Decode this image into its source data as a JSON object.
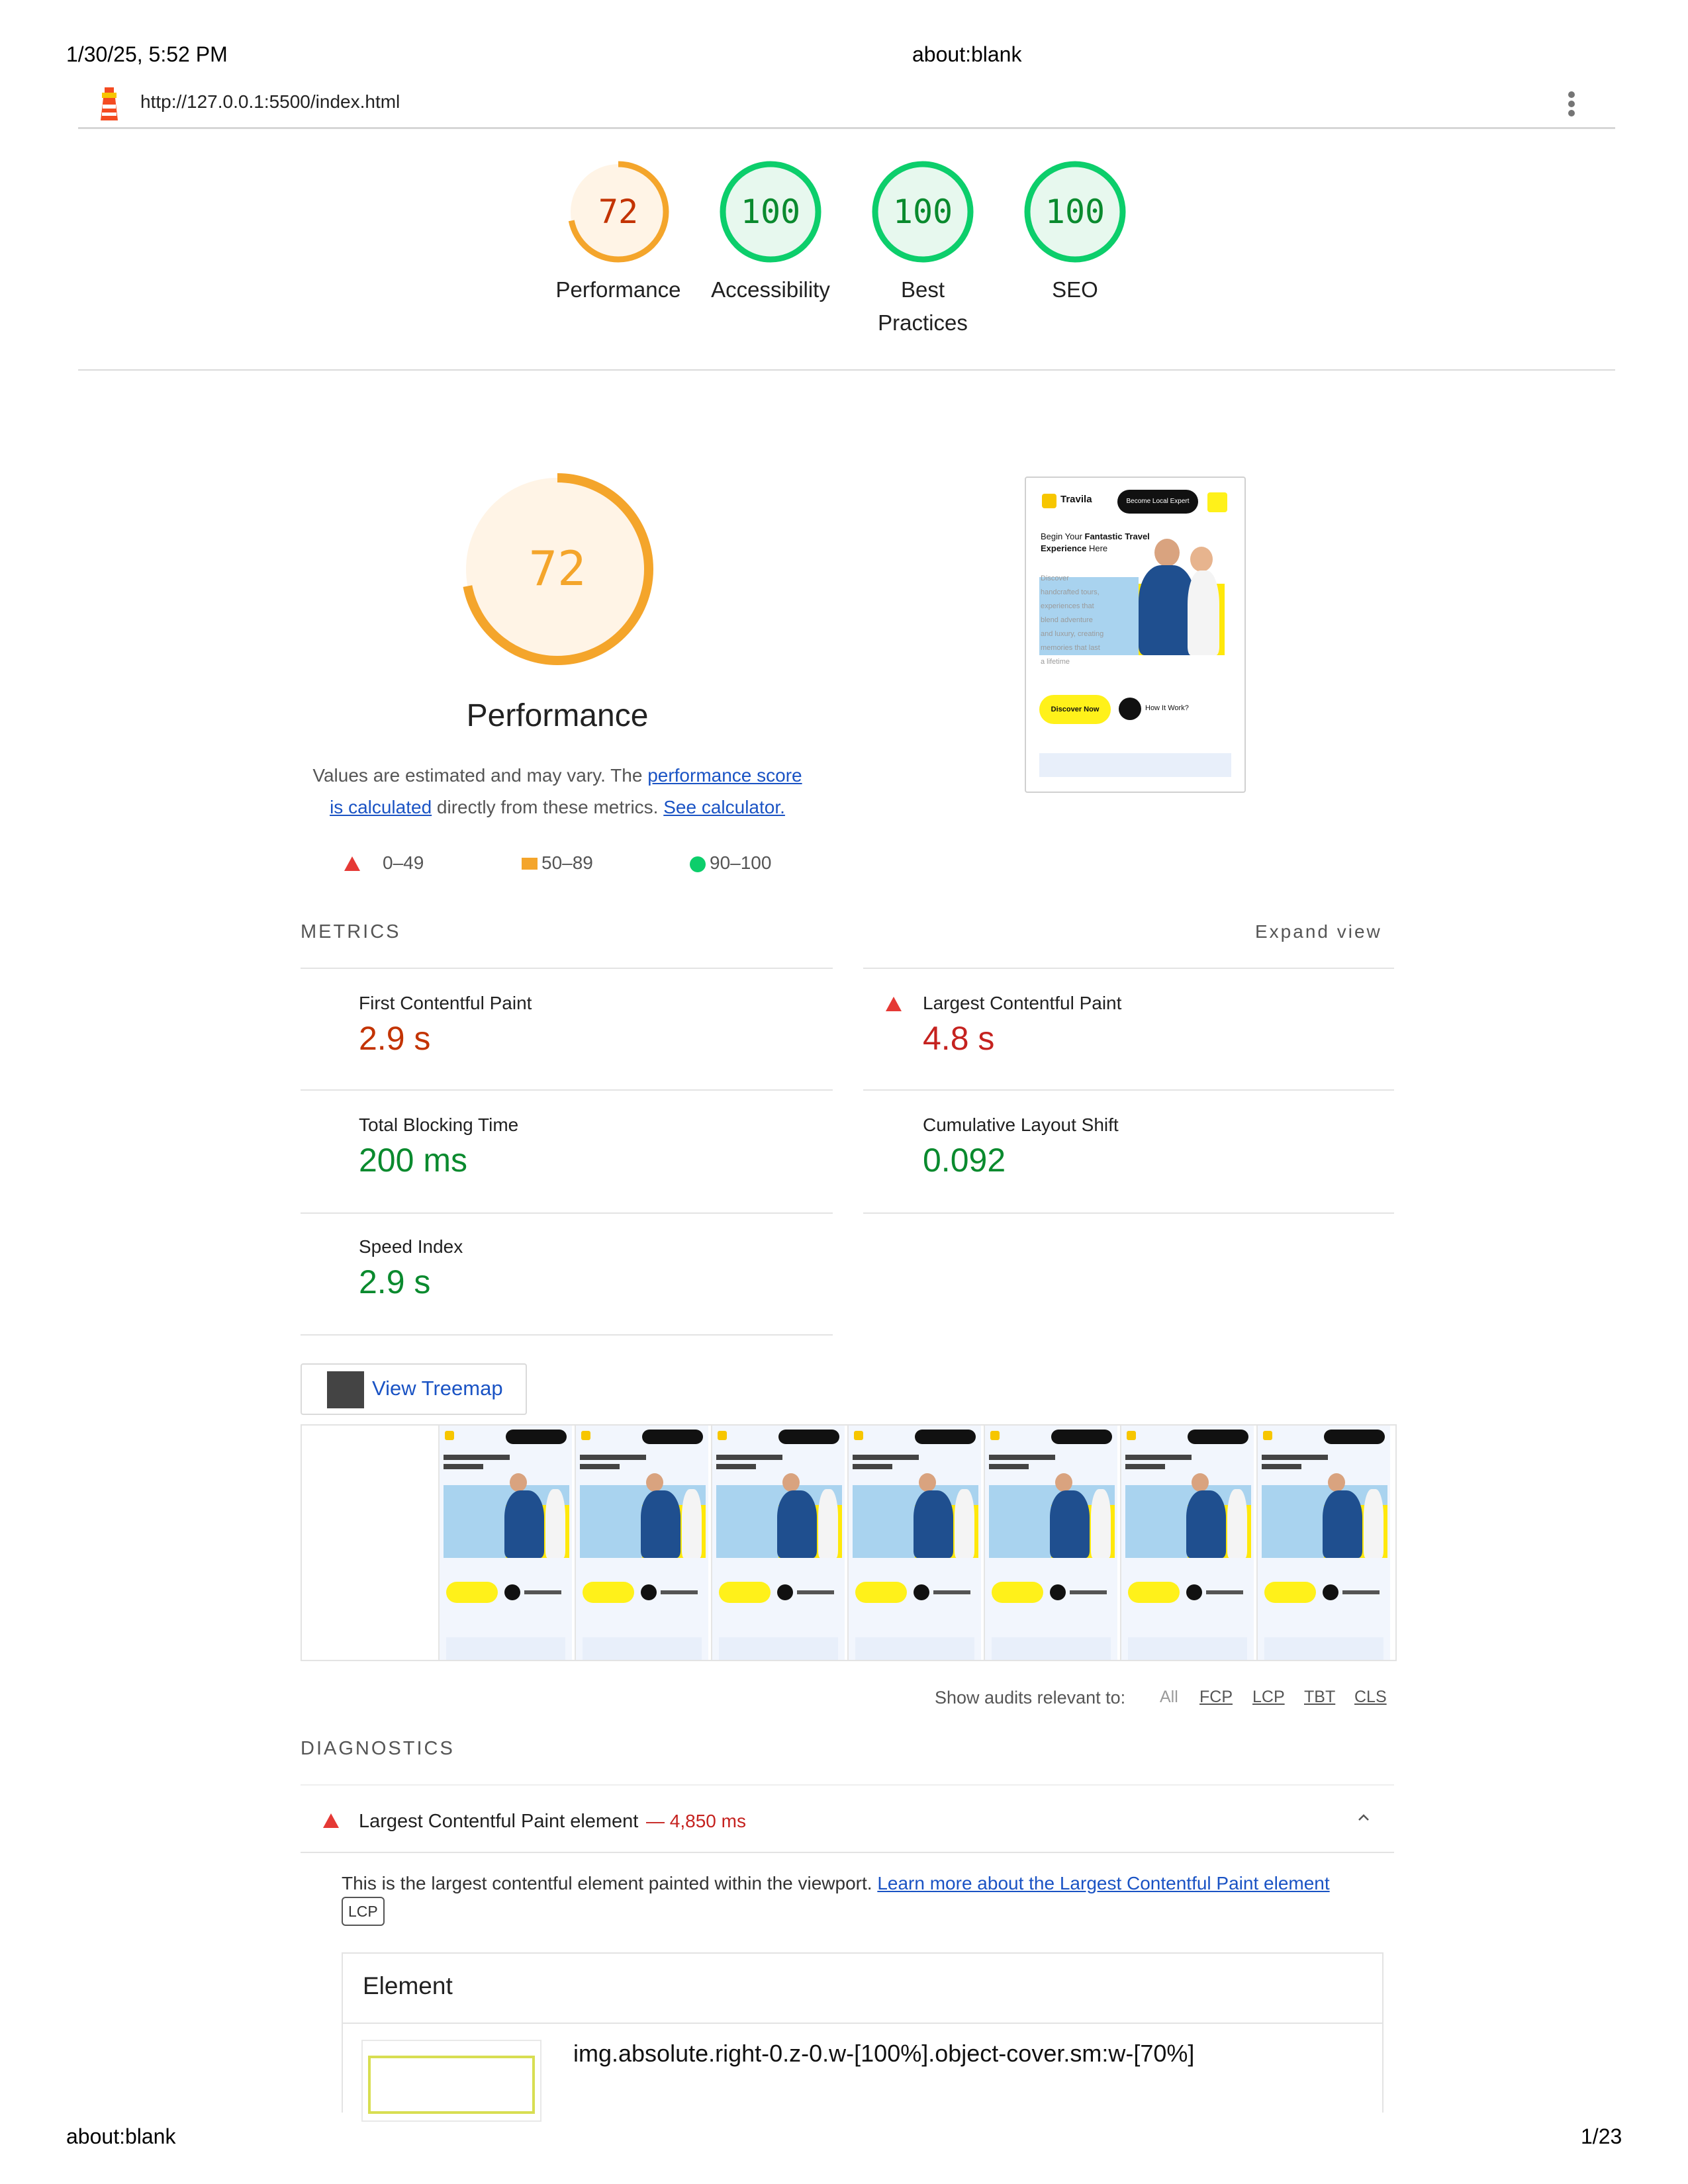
{
  "print_header": {
    "datetime": "1/30/25, 5:52 PM",
    "title": "about:blank"
  },
  "print_footer": {
    "left": "about:blank",
    "right": "1/23"
  },
  "topbar": {
    "url": "http://127.0.0.1:5500/index.html",
    "logo_icon": "lighthouse-icon",
    "menu_icon": "kebab-menu-icon"
  },
  "colors": {
    "average": "#f4a52b",
    "pass": "#0cce6b",
    "fail": "#e53935",
    "link": "#1a53c4"
  },
  "gauges": [
    {
      "score": 72,
      "label": "Performance",
      "status": "average"
    },
    {
      "score": 100,
      "label": "Accessibility",
      "status": "pass"
    },
    {
      "score": 100,
      "label_line1": "Best",
      "label_line2": "Practices",
      "status": "pass"
    },
    {
      "score": 100,
      "label": "SEO",
      "status": "pass"
    }
  ],
  "performance": {
    "score": 72,
    "title": "Performance",
    "desc_prefix": "Values are estimated and may vary. The ",
    "desc_link1_a": "performance score",
    "desc_link1_b": "is calculated",
    "desc_middle": " directly from these metrics. ",
    "desc_link2": "See calculator.",
    "legend": [
      "0–49",
      "50–89",
      "90–100"
    ]
  },
  "screenshot_thumb": {
    "brand": "Travila",
    "cta_top": "Become Local Expert",
    "headline_a": "Begin Your ",
    "headline_b": "Fantastic Travel",
    "headline_c": "Experience",
    "headline_d": " Here",
    "body": [
      "Discover",
      "handcrafted tours,",
      "experiences that",
      "blend adventure",
      "and luxury, creating",
      "memories that last",
      "a lifetime"
    ],
    "btn_discover": "Discover Now",
    "btn_how": "How It Work?"
  },
  "metrics": {
    "heading": "METRICS",
    "expand": "Expand view",
    "fcp": {
      "title": "First Contentful Paint",
      "value": "2.9 s"
    },
    "lcp": {
      "title": "Largest Contentful Paint",
      "value": "4.8 s"
    },
    "tbt": {
      "title": "Total Blocking Time",
      "value": "200 ms"
    },
    "cls": {
      "title": "Cumulative Layout Shift",
      "value": "0.092"
    },
    "si": {
      "title": "Speed Index",
      "value": "2.9 s"
    }
  },
  "treemap_button": "View Treemap",
  "filter": {
    "label": "Show audits relevant to:",
    "options": [
      "All",
      "FCP",
      "LCP",
      "TBT",
      "CLS"
    ]
  },
  "diagnostics": {
    "heading": "DIAGNOSTICS",
    "audit_title": "Largest Contentful Paint element",
    "audit_value": "— 4,850 ms",
    "desc": "This is the largest contentful element painted within the viewport. ",
    "desc_link": "Learn more about the Largest Contentful Paint element",
    "chip": "LCP",
    "table_header": "Element",
    "element_selector": "img.absolute.right-0.z-0.w-[100%].object-cover.sm:w-[70%]"
  }
}
